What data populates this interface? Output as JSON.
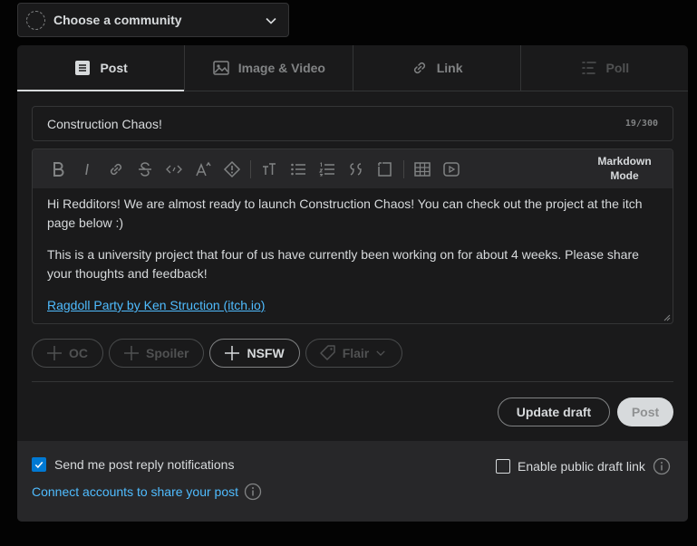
{
  "community": {
    "label": "Choose a community"
  },
  "tabs": [
    {
      "label": "Post",
      "icon": "post-icon",
      "state": "active"
    },
    {
      "label": "Image & Video",
      "icon": "image-icon",
      "state": "normal"
    },
    {
      "label": "Link",
      "icon": "link-icon",
      "state": "normal"
    },
    {
      "label": "Poll",
      "icon": "poll-icon",
      "state": "disabled"
    }
  ],
  "title": {
    "value": "Construction Chaos!",
    "count": "19/300"
  },
  "editor": {
    "mode_line1": "Markdown",
    "mode_line2": "Mode",
    "paragraph1": "Hi Redditors! We are almost ready to launch Construction Chaos!  You can check out the project at the itch page below :)",
    "paragraph2": "This is a university project that four of us have currently been working on for about 4 weeks. Please share your thoughts and feedback!",
    "link_text": "Ragdoll Party by Ken Struction (itch.io)"
  },
  "tags": {
    "oc": "OC",
    "spoiler": "Spoiler",
    "nsfw": "NSFW",
    "flair": "Flair"
  },
  "actions": {
    "update_draft": "Update draft",
    "post": "Post"
  },
  "footer": {
    "notify_label": "Send me post reply notifications",
    "notify_checked": true,
    "connect_label": "Connect accounts to share your post",
    "public_label": "Enable public draft link",
    "public_checked": false
  },
  "colors": {
    "accent_blue": "#0079d3",
    "link_blue": "#4fbcff",
    "panel": "#1a1a1b",
    "background": "#030303"
  }
}
